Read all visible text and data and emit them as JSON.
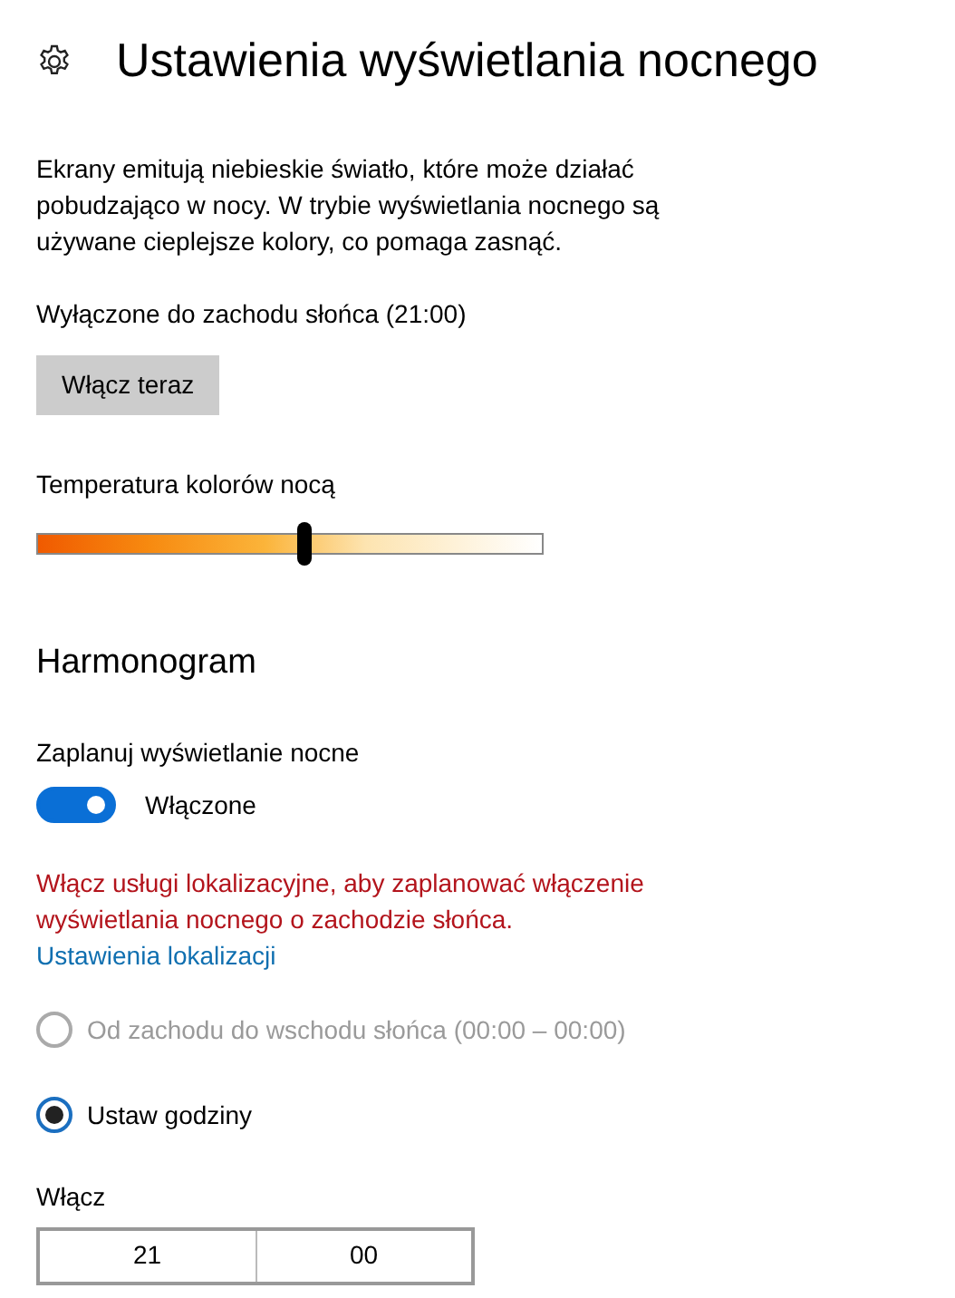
{
  "header": {
    "title": "Ustawienia wyświetlania nocnego"
  },
  "description": "Ekrany emitują niebieskie światło, które może działać pobudzająco w nocy. W trybie wyświetlania nocnego są używane cieplejsze kolory, co pomaga zasnąć.",
  "status": "Wyłączone do zachodu słońca (21:00)",
  "action_button": "Włącz teraz",
  "temperature": {
    "label": "Temperatura kolorów nocą",
    "level": 0.53
  },
  "schedule": {
    "heading": "Harmonogram",
    "toggle": {
      "label": "Zaplanuj wyświetlanie nocne",
      "on": true,
      "state_text": "Włączone"
    },
    "warning": "Włącz usługi lokalizacyjne, aby zaplanować włączenie wyświetlania nocnego o zachodzie słońca.",
    "link": "Ustawienia lokalizacji",
    "options": [
      {
        "label": "Od zachodu do wschodu słońca (00:00 – 00:00)",
        "selected": false,
        "disabled": true
      },
      {
        "label": "Ustaw godziny",
        "selected": true,
        "disabled": false
      }
    ],
    "on_time": {
      "label": "Włącz",
      "hour": "21",
      "minute": "00"
    }
  }
}
